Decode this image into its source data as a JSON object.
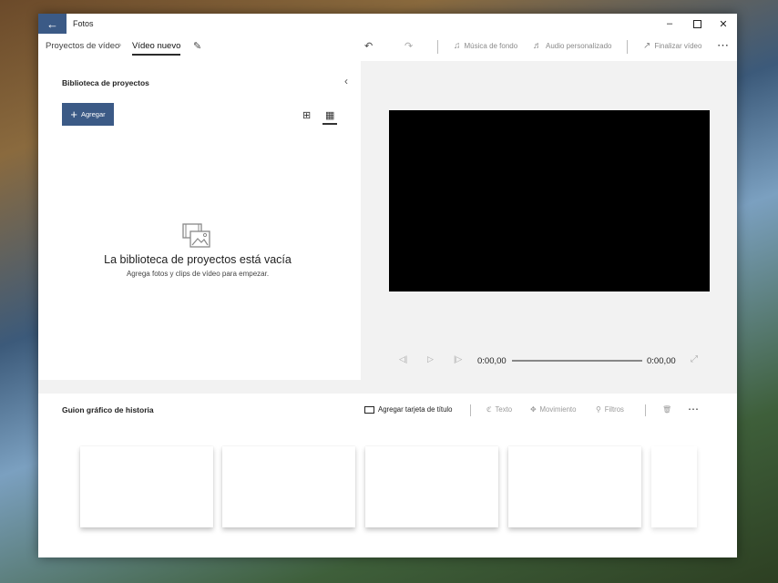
{
  "app": {
    "title": "Fotos"
  },
  "breadcrumb": {
    "parent": "Proyectos de vídeo",
    "current": "Vídeo nuevo"
  },
  "toolbar": {
    "music_label": "Música de fondo",
    "audio_label": "Audio personalizado",
    "finish_label": "Finalizar vídeo"
  },
  "library": {
    "title": "Biblioteca de proyectos",
    "add_label": "Agregar",
    "empty_title": "La biblioteca de proyectos está vacía",
    "empty_subtitle": "Agrega fotos y clips de vídeo para empezar."
  },
  "player": {
    "current_time": "0:00,00",
    "total_time": "0:00,00"
  },
  "storyboard": {
    "title": "Guion gráfico de historia",
    "add_title_card_label": "Agregar tarjeta de título",
    "text_label": "Texto",
    "motion_label": "Movimiento",
    "filters_label": "Filtros"
  },
  "colors": {
    "accent": "#3b5a86",
    "video_bg": "#000000",
    "panel_bg": "#ffffff",
    "window_bg": "#f2f2f2"
  }
}
